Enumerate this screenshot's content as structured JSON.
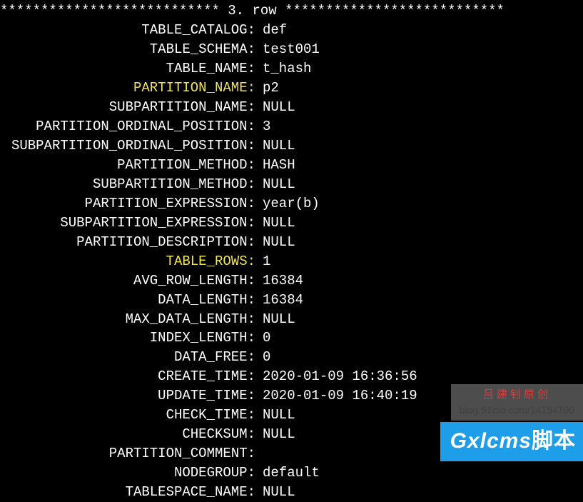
{
  "separator": "*************************** 3. row ***************************",
  "fields": [
    {
      "key": "TABLE_CATALOG:",
      "value": "def",
      "highlight": false
    },
    {
      "key": "TABLE_SCHEMA:",
      "value": "test001",
      "highlight": false
    },
    {
      "key": "TABLE_NAME:",
      "value": "t_hash",
      "highlight": false
    },
    {
      "key": "PARTITION_NAME:",
      "value": "p2",
      "highlight": true
    },
    {
      "key": "SUBPARTITION_NAME:",
      "value": "NULL",
      "highlight": false
    },
    {
      "key": "PARTITION_ORDINAL_POSITION:",
      "value": "3",
      "highlight": false
    },
    {
      "key": "SUBPARTITION_ORDINAL_POSITION:",
      "value": "NULL",
      "highlight": false
    },
    {
      "key": "PARTITION_METHOD:",
      "value": "HASH",
      "highlight": false
    },
    {
      "key": "SUBPARTITION_METHOD:",
      "value": "NULL",
      "highlight": false
    },
    {
      "key": "PARTITION_EXPRESSION:",
      "value": "year(b)",
      "highlight": false
    },
    {
      "key": "SUBPARTITION_EXPRESSION:",
      "value": "NULL",
      "highlight": false
    },
    {
      "key": "PARTITION_DESCRIPTION:",
      "value": "NULL",
      "highlight": false
    },
    {
      "key": "TABLE_ROWS:",
      "value": "1",
      "highlight": true
    },
    {
      "key": "AVG_ROW_LENGTH:",
      "value": "16384",
      "highlight": false
    },
    {
      "key": "DATA_LENGTH:",
      "value": "16384",
      "highlight": false
    },
    {
      "key": "MAX_DATA_LENGTH:",
      "value": "NULL",
      "highlight": false
    },
    {
      "key": "INDEX_LENGTH:",
      "value": "0",
      "highlight": false
    },
    {
      "key": "DATA_FREE:",
      "value": "0",
      "highlight": false
    },
    {
      "key": "CREATE_TIME:",
      "value": "2020-01-09 16:36:56",
      "highlight": false
    },
    {
      "key": "UPDATE_TIME:",
      "value": "2020-01-09 16:40:19",
      "highlight": false
    },
    {
      "key": "CHECK_TIME:",
      "value": "NULL",
      "highlight": false
    },
    {
      "key": "CHECKSUM:",
      "value": "NULL",
      "highlight": false
    },
    {
      "key": "PARTITION_COMMENT:",
      "value": "",
      "highlight": false
    },
    {
      "key": "NODEGROUP:",
      "value": "default",
      "highlight": false
    },
    {
      "key": "TABLESPACE_NAME:",
      "value": "NULL",
      "highlight": false
    }
  ],
  "watermark": {
    "line1": "吕建钊原创",
    "line2": "blog.51cto.com/14154700"
  },
  "logo": {
    "text1": "Gxlcms",
    "text2": "脚本"
  }
}
